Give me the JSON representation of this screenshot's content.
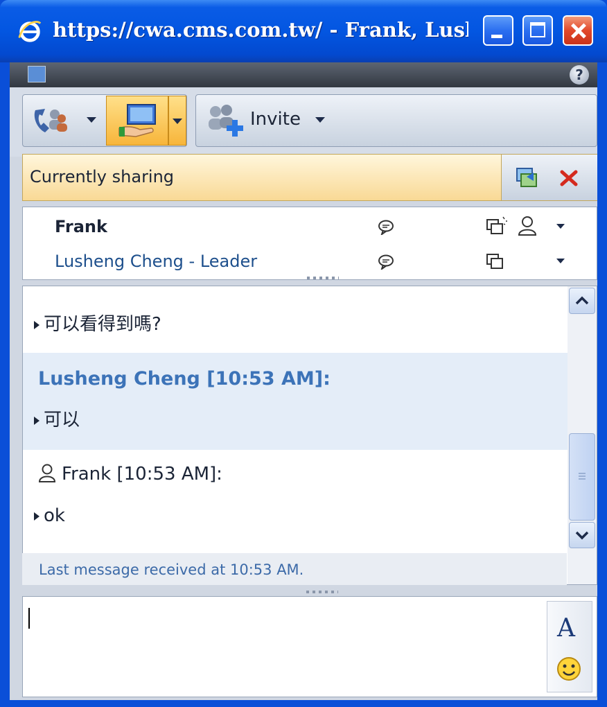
{
  "window": {
    "title": "https://cwa.cms.com.tw/ - Frank, Lushe...",
    "controls": {
      "minimize": "minimize",
      "maximize": "maximize",
      "close": "close"
    }
  },
  "toolbar": {
    "invite_label": "Invite"
  },
  "sharing_banner": {
    "text": "Currently sharing"
  },
  "participants": [
    {
      "name": "Frank"
    },
    {
      "name": "Lusheng Cheng - Leader"
    }
  ],
  "chat": {
    "messages": [
      {
        "text": "可以看得到嗎?"
      },
      {
        "sender": "Lusheng Cheng [10:53 AM]:",
        "text": "可以"
      },
      {
        "sender": "Frank [10:53 AM]:",
        "text": "ok"
      }
    ],
    "status": "Last message received at 10:53 AM."
  },
  "input": {
    "font_button": "A"
  },
  "colors": {
    "titlebar": "#0356e1",
    "highlight": "#e4edf8",
    "sender_accent": "#3c73b8",
    "share_active": "#f7b53a"
  }
}
